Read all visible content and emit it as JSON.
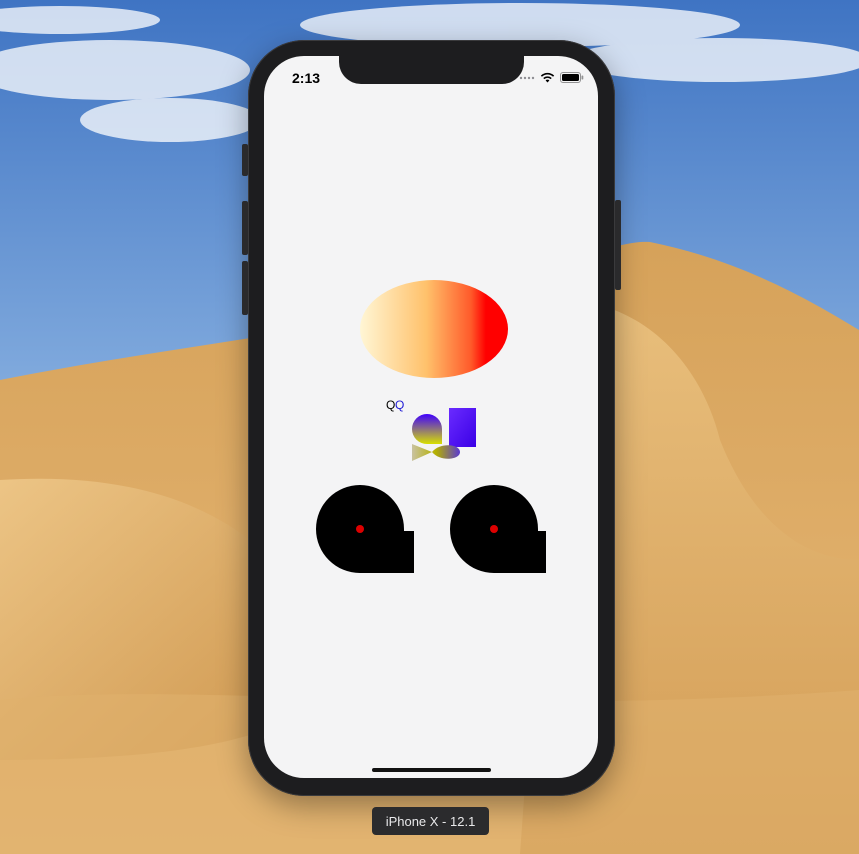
{
  "simulator": {
    "device_label": "iPhone X - 12.1"
  },
  "status_bar": {
    "time": "2:13",
    "signal_icon": "signal-dots-icon",
    "wifi_icon": "wifi-icon",
    "battery_icon": "battery-icon"
  },
  "app": {
    "text_q_black": "Q",
    "text_q_blue": "Q",
    "colors": {
      "gradient_start": "#fff6d5",
      "gradient_end": "#ff0000",
      "mini_gradient_top": "#3f00ff",
      "mini_gradient_bottom": "#d8e000",
      "shape_fill": "#000000",
      "dot_fill": "#dd0000",
      "q_blue": "#1f1bd6"
    }
  }
}
